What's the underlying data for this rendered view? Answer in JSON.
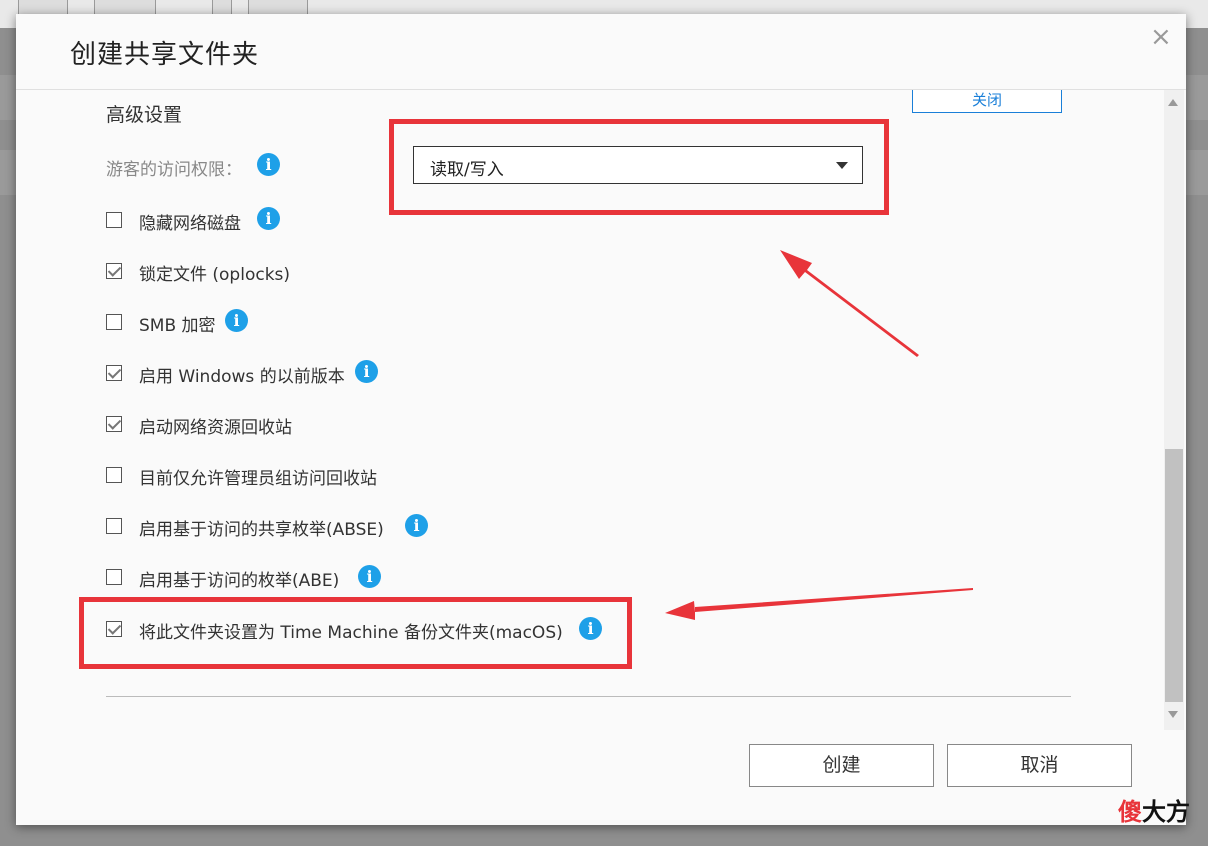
{
  "dialog": {
    "title": "创建共享文件夹",
    "section_title": "高级设置",
    "close_section_label": "关闭",
    "guest_access": {
      "label": "游客的访问权限：",
      "selected_value": "读取/写入"
    },
    "options": [
      {
        "id": "hide-network-drive",
        "label": "隐藏网络磁盘",
        "checked": false,
        "info": true
      },
      {
        "id": "oplocks",
        "label": "锁定文件 (oplocks)",
        "checked": true,
        "info": false
      },
      {
        "id": "smb-encryption",
        "label": "SMB 加密",
        "checked": false,
        "info": true
      },
      {
        "id": "windows-previous-versions",
        "label": "启用 Windows 的以前版本",
        "checked": true,
        "info": true
      },
      {
        "id": "network-recycle-bin",
        "label": "启动网络资源回收站",
        "checked": true,
        "info": false
      },
      {
        "id": "admin-only-recycle-bin",
        "label": "目前仅允许管理员组访问回收站",
        "checked": false,
        "info": false
      },
      {
        "id": "abse",
        "label": "启用基于访问的共享枚举(ABSE)",
        "checked": false,
        "info": true
      },
      {
        "id": "abe",
        "label": "启用基于访问的枚举(ABE)",
        "checked": false,
        "info": true
      },
      {
        "id": "time-machine",
        "label": "将此文件夹设置为 Time Machine 备份文件夹(macOS)",
        "checked": true,
        "info": true
      }
    ],
    "buttons": {
      "create": "创建",
      "cancel": "取消"
    }
  },
  "info_icon_glyph": "i",
  "close_icon_glyph": "×",
  "watermark": {
    "first_char": "傻",
    "rest": "大方"
  },
  "colors": {
    "accent": "#1a7fd8",
    "info": "#1ea0e8",
    "annotation_red": "#e8343a"
  }
}
